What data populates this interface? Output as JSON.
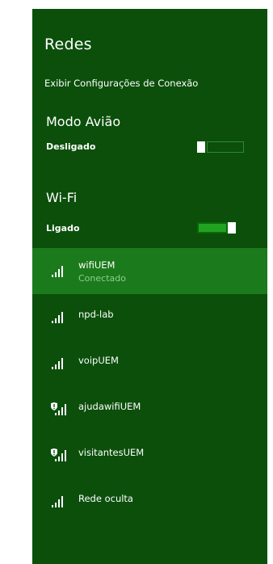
{
  "panel": {
    "title": "Redes",
    "connection_settings_label": "Exibir Configurações de Conexão"
  },
  "airplane_mode": {
    "heading": "Modo Avião",
    "state": "Desligado",
    "on": false
  },
  "wifi": {
    "heading": "Wi-Fi",
    "state": "Ligado",
    "on": true
  },
  "networks": [
    {
      "name": "wifiUEM",
      "status": "Conectado",
      "secured_warning": false,
      "icon": "wifi-signal-icon"
    },
    {
      "name": "npd-lab",
      "secured_warning": false,
      "icon": "wifi-signal-icon"
    },
    {
      "name": "voipUEM",
      "secured_warning": false,
      "icon": "wifi-signal-icon"
    },
    {
      "name": "ajudawifiUEM",
      "secured_warning": true,
      "icon": "wifi-signal-shield-icon"
    },
    {
      "name": "visitantesUEM",
      "secured_warning": true,
      "icon": "wifi-signal-shield-icon"
    },
    {
      "name": "Rede oculta",
      "secured_warning": false,
      "icon": "wifi-signal-icon"
    }
  ],
  "colors": {
    "panel_background": "#0b4f0b",
    "selected_row": "#1b7a1b",
    "toggle_on": "#21a321",
    "connected_status": "#8fcf8f"
  }
}
